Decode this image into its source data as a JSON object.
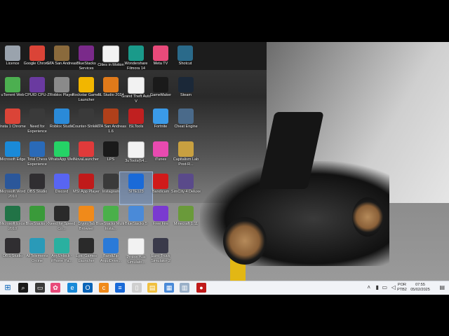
{
  "desktop": {
    "icons": [
      {
        "label": "Licence",
        "icon": "license-icon",
        "color": "#9aa3ad"
      },
      {
        "label": "Google Chrome",
        "icon": "chrome-icon",
        "color": "#db4437"
      },
      {
        "label": "GTA San Andreas",
        "icon": "gta-sa-icon",
        "color": "#8a6a3c"
      },
      {
        "label": "BlueStacks Services",
        "icon": "winrar-icon",
        "color": "#7a2a8a"
      },
      {
        "label": "",
        "icon": "file-icon",
        "color": "#f2f2f2"
      },
      {
        "label": "Cities in Motion",
        "icon": "file-icon",
        "color": "#f2f2f2"
      },
      {
        "label": "Wondershare Filmora 14",
        "icon": "filmora-icon",
        "color": "#1a9a8a"
      },
      {
        "label": "Meta TV",
        "icon": "meta-tv-icon",
        "color": "#e84a7a"
      },
      {
        "label": "Shotcut",
        "icon": "shotcut-icon",
        "color": "#2a6a8a"
      },
      {
        "label": "uTorrent Web",
        "icon": "utorrent-icon",
        "color": "#4caf50"
      },
      {
        "label": "CPUID CPU-Z",
        "icon": "cpuz-icon",
        "color": "#6a3aa0"
      },
      {
        "label": "Roblox Player",
        "icon": "roblox-icon",
        "color": "#8a8a8a"
      },
      {
        "label": "Rockstar Games Launcher",
        "icon": "rockstar-icon",
        "color": "#f2b600"
      },
      {
        "label": "FL Studio 2024",
        "icon": "fl-studio-icon",
        "color": "#e07a1a"
      },
      {
        "label": "Grand Theft Auto V",
        "icon": "file-icon",
        "color": "#f2f2f2"
      },
      {
        "label": "GameMaker",
        "icon": "gamemaker-icon",
        "color": "#1a1a1a"
      },
      {
        "label": "Steam",
        "icon": "steam-icon",
        "color": "#1b2838"
      },
      {
        "label": "Insta 1 Chrome",
        "icon": "chrome-icon",
        "color": "#db4437"
      },
      {
        "label": "Need for Experience",
        "icon": "nfs-icon",
        "color": "#3a3a3a"
      },
      {
        "label": "Roblox Studio",
        "icon": "roblox-studio-icon",
        "color": "#2a8ad8"
      },
      {
        "label": "Counter-Strike 2",
        "icon": "cs2-icon",
        "color": "#3a3a3a"
      },
      {
        "label": "MTA San Andreas 1.6",
        "icon": "mta-icon",
        "color": "#b0401a"
      },
      {
        "label": "ISLTools",
        "icon": "isl-icon",
        "color": "#c02020"
      },
      {
        "label": "Fortnite",
        "icon": "fortnite-icon",
        "color": "#3a9ae8"
      },
      {
        "label": "Cheat Engine",
        "icon": "cheat-engine-icon",
        "color": "#4a6a8a"
      },
      {
        "label": "Microsoft Edge",
        "icon": "edge-icon",
        "color": "#1a8ad8"
      },
      {
        "label": "Total Chess Experience",
        "icon": "chess-icon",
        "color": "#2a6ab8"
      },
      {
        "label": "WhatsApp Web",
        "icon": "whatsapp-icon",
        "color": "#25d366"
      },
      {
        "label": "NovaLauncher",
        "icon": "nova-icon",
        "color": "#e03a3a"
      },
      {
        "label": "LPS",
        "icon": "lps-icon",
        "color": "#1a1a1a"
      },
      {
        "label": "3uTools(64...",
        "icon": "file-icon",
        "color": "#f2f2f2"
      },
      {
        "label": "iTunes",
        "icon": "itunes-icon",
        "color": "#e84ab0"
      },
      {
        "label": "Capitalism Lab Post-R...",
        "icon": "capitalism-icon",
        "color": "#c8a040"
      },
      {
        "label": "Microsoft Word 2010",
        "icon": "word-icon",
        "color": "#2b579a"
      },
      {
        "label": "OBS Studio",
        "icon": "obs-icon",
        "color": "#302e31"
      },
      {
        "label": "Discord",
        "icon": "discord-icon",
        "color": "#5865f2"
      },
      {
        "label": "MSI App Player",
        "icon": "msi-icon",
        "color": "#c01a1a"
      },
      {
        "label": "Instagram",
        "icon": "instagram-icon",
        "color": "#3a3a3a"
      },
      {
        "label": "SITE123",
        "icon": "site123-icon",
        "color": "#1a6ad8"
      },
      {
        "label": "Bandicam",
        "icon": "bandicam-icon",
        "color": "#d01a1a"
      },
      {
        "label": "SimCity 4 Deluxe",
        "icon": "simcity-icon",
        "color": "#5a4a8a"
      },
      {
        "label": "Microsoft Excel 2010",
        "icon": "excel-icon",
        "color": "#217346"
      },
      {
        "label": "BlueStacks X",
        "icon": "bluestacks-x-icon",
        "color": "#3a9a3a"
      },
      {
        "label": "Need for Speed Co...",
        "icon": "nfs-icon",
        "color": "#2a2a2a"
      },
      {
        "label": "CryptoTab Browser",
        "icon": "cryptotab-icon",
        "color": "#f08a1a"
      },
      {
        "label": "BlueStacks Multi-Insta...",
        "icon": "bluestacks-icon",
        "color": "#4ab04a"
      },
      {
        "label": "BlueStacks 5",
        "icon": "bluestacks-icon",
        "color": "#4a8ad8"
      },
      {
        "label": "Free Fire",
        "icon": "freefire-icon",
        "color": "#7a3ad0"
      },
      {
        "label": "Minecraft 1.11",
        "icon": "minecraft-icon",
        "color": "#6a9a3a"
      },
      {
        "label": "OBS Studio",
        "icon": "obs-icon",
        "color": "#302e31"
      },
      {
        "label": "AllTelements Online",
        "icon": "alltelements-icon",
        "color": "#2a9ab8"
      },
      {
        "label": "AnyUnlock - iPhone Pa...",
        "icon": "anyunlock-icon",
        "color": "#2ab0a0"
      },
      {
        "label": "Epic Games Launcher",
        "icon": "epic-icon",
        "color": "#2a2a2a"
      },
      {
        "label": "BandiZip ArquiDrive...",
        "icon": "lock-icon",
        "color": "#2a7ad8"
      },
      {
        "label": "Proton Bus Simulato...",
        "icon": "file-icon",
        "color": "#f2f2f2"
      },
      {
        "label": "Euro Truck Simulator 2",
        "icon": "ets2-icon",
        "color": "#3a3a4a"
      }
    ],
    "selected_label": "SITE123"
  },
  "taskbar": {
    "start": "windows-start-icon",
    "items": [
      {
        "name": "search-icon",
        "color": "#1a1a1a",
        "glyph": "⌕"
      },
      {
        "name": "task-view-icon",
        "color": "#3a3a3a",
        "glyph": "▭"
      },
      {
        "name": "google-photos-icon",
        "color": "#e84a7a",
        "glyph": "✿"
      },
      {
        "name": "edge-icon",
        "color": "#1a8ad8",
        "glyph": "e"
      },
      {
        "name": "outlook-icon",
        "color": "#0a64b8",
        "glyph": "O"
      },
      {
        "name": "cryptotab-icon",
        "color": "#f08a1a",
        "glyph": "c"
      },
      {
        "name": "site123-icon",
        "color": "#1a6ad8",
        "glyph": "≡"
      },
      {
        "name": "file-icon",
        "color": "#cfcfcf",
        "glyph": "▯"
      },
      {
        "name": "folder-icon",
        "color": "#f0c040",
        "glyph": "▤"
      },
      {
        "name": "explorer-icon",
        "color": "#4a8ad8",
        "glyph": "▦"
      },
      {
        "name": "notepad-icon",
        "color": "#9ab0c8",
        "glyph": "▥"
      },
      {
        "name": "whatsapp-icon",
        "color": "#25d366",
        "glyph": "●"
      },
      {
        "name": "ladybug-icon",
        "color": "#c01a1a",
        "glyph": "●"
      }
    ],
    "lang_line1": "POR",
    "lang_line2": "PTB2",
    "time": "07:55",
    "date": "05/02/2025"
  }
}
